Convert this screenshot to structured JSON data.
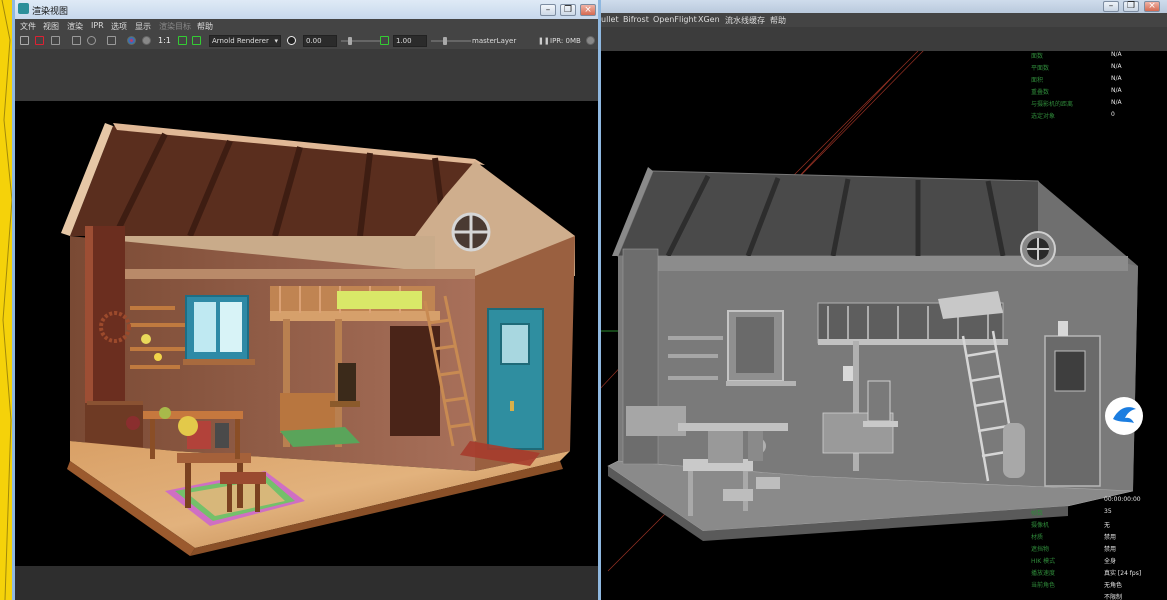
{
  "render_view": {
    "title": "渲染视图",
    "menu": [
      "文件",
      "视图",
      "渲染",
      "IPR",
      "选项",
      "显示",
      "渲染目标",
      "帮助"
    ],
    "toolbar": {
      "ratio": "1:1",
      "renderer": "Arnold Renderer",
      "exposure": "0.00",
      "gamma": "1.00",
      "layer": "masterLayer",
      "ipr_status": "IPR: 0MB"
    }
  },
  "maya": {
    "menubar": [
      "ullet",
      "Bifrost",
      "OpenFlight",
      "XGen",
      "流水线缓存",
      "帮助"
    ],
    "hud_top": [
      {
        "label": "面数",
        "value": "N/A"
      },
      {
        "label": "平面数",
        "value": "N/A"
      },
      {
        "label": "面积",
        "value": "N/A"
      },
      {
        "label": "重叠数",
        "value": "N/A"
      },
      {
        "label": "与摄影机的距离",
        "value": "N/A"
      },
      {
        "label": "选定对象",
        "value": "0"
      }
    ],
    "hud_bottom": [
      {
        "label": "",
        "value": "00:00:00:00"
      },
      {
        "label": "帧数",
        "value": "35"
      },
      {
        "label": "摄像机",
        "value": "无"
      },
      {
        "label": "材质",
        "value": "禁用"
      },
      {
        "label": "遮挡物",
        "value": "禁用"
      },
      {
        "label": "HIK 模式",
        "value": "全身"
      },
      {
        "label": "播放速度",
        "value": "真实 [24 fps]"
      },
      {
        "label": "当前角色",
        "value": "无角色"
      },
      {
        "label": "",
        "value": "不限制"
      }
    ]
  },
  "colors": {
    "hud_label": "#2f8a3a",
    "hud_value": "#e6e6e6",
    "window_border": "#8fb8e0",
    "left_strip": "#f5d20a"
  }
}
